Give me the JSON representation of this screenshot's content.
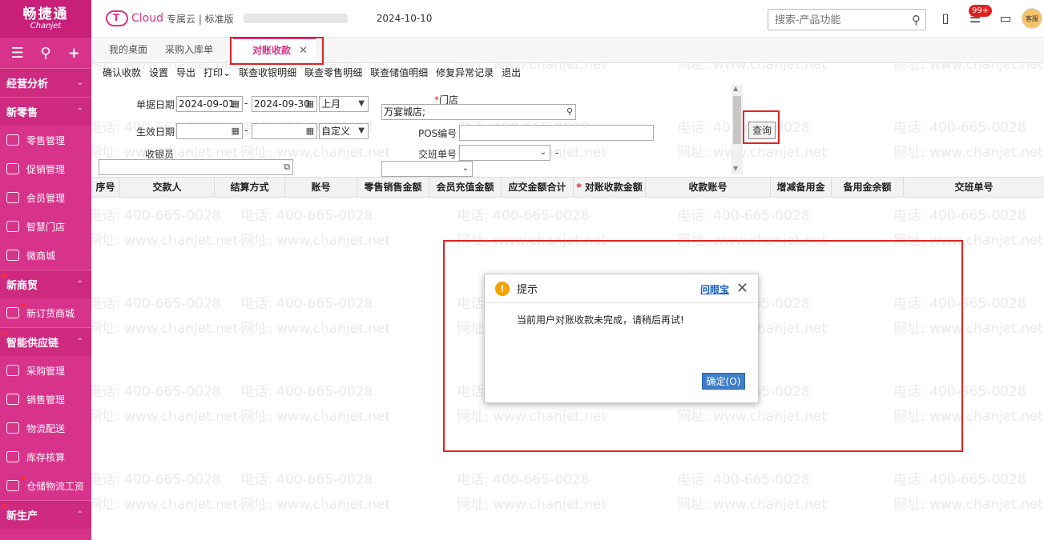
{
  "sidebar": {
    "logo_cn": "畅捷通",
    "logo_en": "Chanjet",
    "tools": {
      "menu": "☰",
      "search": "⚲",
      "add": "+"
    },
    "groups": [
      {
        "label": "经营分析",
        "chevron": "⌄"
      },
      {
        "label": "新零售",
        "chevron": "⌃"
      },
      {
        "label": "新商贸",
        "chevron": "⌃"
      },
      {
        "label": "智能供应链",
        "chevron": "⌃"
      },
      {
        "label": "新生产",
        "chevron": "⌃"
      }
    ],
    "items_retail": [
      "零售管理",
      "促销管理",
      "会员管理",
      "智慧门店",
      "微商城"
    ],
    "items_trade": [
      "新订货商城"
    ],
    "items_supply": [
      "采购管理",
      "销售管理",
      "物流配送",
      "库存核算",
      "仓储物流工资"
    ]
  },
  "topbar": {
    "cloud": "Cloud",
    "edition": "专属云 | 标准版",
    "date": "2024-10-10",
    "search_placeholder": "搜索-产品功能",
    "badge": "99+",
    "avatar_text": "客服"
  },
  "tabs": {
    "items": [
      "我的桌面",
      "采购入库单"
    ],
    "active": "对账收款",
    "close": "✕"
  },
  "toolbar": [
    "确认收款",
    "设置",
    "导出",
    "打印⌄",
    "联查收银明细",
    "联查零售明细",
    "联查储值明细",
    "修复异常记录",
    "退出"
  ],
  "filter": {
    "doc_date_label": "单据日期",
    "doc_date_from": "2024-09-01",
    "doc_date_to": "2024-09-30",
    "doc_date_period": "上月",
    "effective_date_label": "生效日期",
    "effective_period": "自定义",
    "cashier_label": "收银员",
    "store_label": "门店",
    "store_value": "万宴城店;",
    "pos_label": "POS编号",
    "shift_label": "交班单号",
    "dash": "-",
    "query_button": "查询"
  },
  "table": {
    "columns": [
      "序号",
      "交款人",
      "结算方式",
      "账号",
      "零售销售金额",
      "会员充值金额",
      "应交金额合计",
      "对账收款金额",
      "收款账号",
      "增减备用金",
      "备用金余额",
      "交班单号"
    ]
  },
  "watermark": {
    "phone": "电话: 400-665-0028",
    "site": "网址: www.chanjet.net"
  },
  "dialog": {
    "title": "提示",
    "help": "问眼宝",
    "close": "✕",
    "message": "当前用户对账收款未完成，请稍后再试!",
    "ok": "确定(O)"
  },
  "colors": {
    "brand": "#d8338a",
    "highlight": "#e12323",
    "ok_button": "#3e7ec9"
  }
}
